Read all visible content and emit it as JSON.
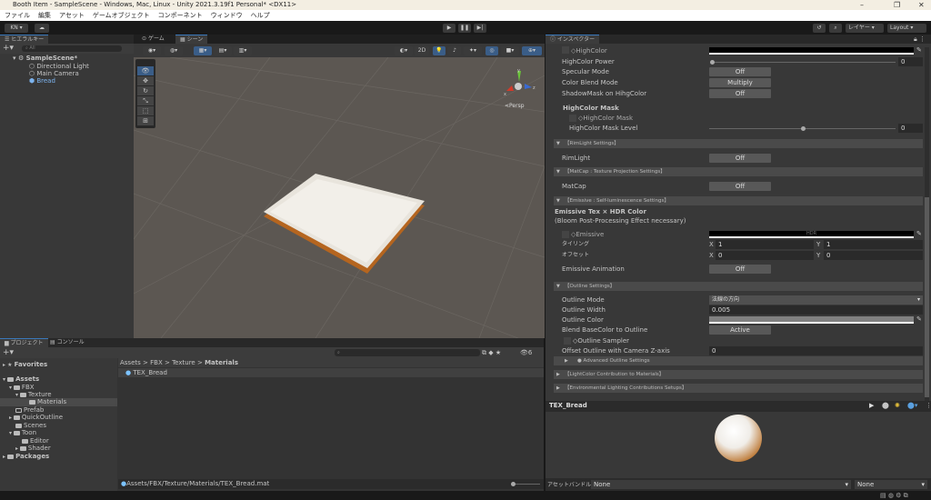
{
  "window": {
    "title": "Booth Item - SampleScene - Windows, Mac, Linux - Unity 2021.3.19f1 Personal* <DX11>",
    "minimize": "–",
    "maximize": "❐",
    "close": "✕"
  },
  "menu": [
    "ファイル",
    "編集",
    "アセット",
    "ゲームオブジェクト",
    "コンポーネント",
    "ウィンドウ",
    "ヘルプ"
  ],
  "toolbar": {
    "account": "KN ▾",
    "layers": "レイヤー",
    "layout": "Layout"
  },
  "hierarchy": {
    "tab": "ヒエラルキー",
    "search_placeholder": "All",
    "scene": "SampleScene*",
    "items": [
      "Directional Light",
      "Main Camera",
      "Bread"
    ]
  },
  "scene": {
    "tabs": [
      "ゲーム",
      "シーン"
    ],
    "btn_2d": "2D",
    "persp": "Persp",
    "axis": {
      "x": "x",
      "y": "y",
      "z": "z"
    }
  },
  "inspector": {
    "tab": "インスペクター",
    "highcolor": "◇HighColor",
    "highcolor_power": "HighColor Power",
    "highcolor_power_value": "0",
    "highcolor_power_fraction": 0,
    "specular_mode": "Specular Mode",
    "specular_value": "Off",
    "color_blend_mode": "Color Blend Mode",
    "color_blend_value": "Multiply",
    "shadowmask": "ShadowMask on HihgColor",
    "shadowmask_value": "Off",
    "highcolor_mask_header": "HighColor Mask",
    "highcolor_mask": "◇HighColor Mask",
    "mask_level": "HighColor Mask Level",
    "mask_level_value": "0",
    "mask_level_fraction": 0.5,
    "rim_section": "【RimLight Settings】",
    "rimlight": "RimLight",
    "rimlight_value": "Off",
    "matcap_section": "【MatCap : Texture Projection Settings】",
    "matcap": "MatCap",
    "matcap_value": "Off",
    "emissive_section": "【Emissive : Self-luminescence Settings】",
    "emissive_header": "Emissive Tex × HDR Color",
    "emissive_note": "(Bloom Post-Processing Effect necessary)",
    "emissive": "◇Emissive",
    "hdr": "HDR",
    "tiling": "タイリング",
    "offset": "オフセット",
    "x": "X",
    "y": "Y",
    "tiling_x": "1",
    "tiling_y": "1",
    "offset_x": "0",
    "offset_y": "0",
    "emissive_anim": "Emissive Animation",
    "emissive_anim_value": "Off",
    "outline_section": "【Outline Settings】",
    "outline_mode": "Outline Mode",
    "outline_mode_value": "法線の方向",
    "outline_width": "Outline Width",
    "outline_width_value": "0.005",
    "outline_color": "Outline Color",
    "blend_base": "Blend BaseColor to Outline",
    "blend_base_value": "Active",
    "outline_sampler": "◇Outline Sampler",
    "offset_z": "Offset Outline with Camera Z-axis",
    "offset_z_value": "0",
    "advanced": "● Advanced Outline Settings",
    "lightcolor_section": "【LightColor Contribution to Materials】",
    "env_section": "【Environmental Lighting Contributions Setups】",
    "preview_title": "TEX_Bread",
    "assetbundle": "アセットバンドル",
    "bundle_name": "None",
    "bundle_variant": "None"
  },
  "project": {
    "tabs": [
      "プロジェクト",
      "コンソール"
    ],
    "favorites": "Favorites",
    "assets": "Assets",
    "tree": [
      "FBX",
      "Texture",
      "Materials",
      "Prefab",
      "QuickOutline",
      "Scenes",
      "Toon",
      "Editor",
      "Shader"
    ],
    "packages": "Packages",
    "breadcrumb": [
      "Assets",
      "FBX",
      "Texture",
      "Materials"
    ],
    "sep": ">",
    "file": "TEX_Bread",
    "path": "Assets/FBX/Texture/Materials/TEX_Bread.mat",
    "hidden_count": "6"
  }
}
